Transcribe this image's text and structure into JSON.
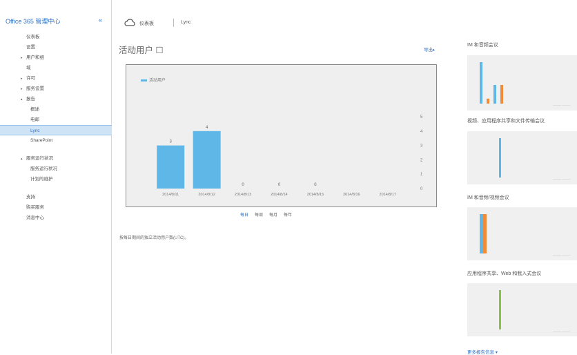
{
  "sidebar": {
    "title": "Office 365 管理中心",
    "collapse_icon": "chevron-left-icon",
    "items": [
      {
        "label": "仪表板",
        "level": 0,
        "expand": "",
        "selected": false
      },
      {
        "label": "设置",
        "level": 0,
        "expand": "",
        "selected": false
      },
      {
        "label": "用户和组",
        "level": 0,
        "expand": "▸",
        "selected": false
      },
      {
        "label": "域",
        "level": 0,
        "expand": "",
        "selected": false
      },
      {
        "label": "许可",
        "level": 0,
        "expand": "▸",
        "selected": false
      },
      {
        "label": "服务设置",
        "level": 0,
        "expand": "▸",
        "selected": false
      },
      {
        "label": "报告",
        "level": 0,
        "expand": "▴",
        "selected": false
      },
      {
        "label": "概述",
        "level": 1,
        "expand": "",
        "selected": false
      },
      {
        "label": "电邮",
        "level": 1,
        "expand": "",
        "selected": false
      },
      {
        "label": "Lync",
        "level": 1,
        "expand": "",
        "selected": true
      },
      {
        "label": "SharePoint",
        "level": 1,
        "expand": "",
        "selected": false
      },
      {
        "label": "",
        "level": -1,
        "expand": "",
        "selected": false
      },
      {
        "label": "服务运行状况",
        "level": 0,
        "expand": "▴",
        "selected": false
      },
      {
        "label": "服务运行状况",
        "level": 1,
        "expand": "",
        "selected": false
      },
      {
        "label": "计划的维护",
        "level": 1,
        "expand": "",
        "selected": false
      },
      {
        "label": "",
        "level": -1,
        "expand": "",
        "selected": false
      },
      {
        "label": "支持",
        "level": 0,
        "expand": "",
        "selected": false
      },
      {
        "label": "购买服务",
        "level": 0,
        "expand": "",
        "selected": false
      },
      {
        "label": "消息中心",
        "level": 0,
        "expand": "",
        "selected": false
      }
    ]
  },
  "topbar": {
    "icon": "cloud-icon",
    "title": "仪表板",
    "subtitle": "Lync"
  },
  "main": {
    "title": "活动用户 ☐",
    "export_label": "导出▸",
    "tabs": [
      "每日",
      "每周",
      "每月",
      "每年"
    ],
    "active_tab": 0,
    "note": "按每日期间的独立活动用户数(UTC)。"
  },
  "chart_data": {
    "type": "bar",
    "legend": [
      "活动用户"
    ],
    "categories": [
      "2014/8/11",
      "2014/8/12",
      "2014/8/13",
      "2014/8/14",
      "2014/8/15",
      "2014/8/16",
      "2014/8/17"
    ],
    "values": [
      3,
      4,
      0,
      0,
      0,
      0,
      0
    ],
    "value_labels": [
      "3",
      "4",
      "0",
      "0",
      "0",
      "",
      ""
    ],
    "ylim": [
      0,
      5
    ],
    "yticks": [
      "0",
      "1",
      "2",
      "3",
      "4",
      "5"
    ],
    "y_axis_side": "right",
    "bar_color": "#5fb7e8"
  },
  "right_panel": {
    "cards": [
      {
        "title": "IM 和音频会议",
        "footer": "——— ———",
        "bars": [
          {
            "color": "#5fb7e8",
            "value": 1.0,
            "slot": 0
          },
          {
            "color": "#5fb7e8",
            "value": 0.45,
            "slot": 1
          },
          {
            "color": "#f08b3a",
            "value": 0.45,
            "slot": 2
          },
          {
            "color": "#f08b3a",
            "value": 0.12,
            "slot": 0.55
          }
        ]
      },
      {
        "title": "视频、应用程序共享和文件传输会议",
        "footer": "——— ———",
        "bars": [
          {
            "color": "#5fb7e8",
            "value": 1.0,
            "slot": 0.55
          }
        ]
      },
      {
        "title": "IM 和音频/视频会议",
        "footer": "——— ———",
        "bars": [
          {
            "color": "#5fb7e8",
            "value": 1.0,
            "slot": 0
          },
          {
            "color": "#f08b3a",
            "value": 1.0,
            "slot": 0.35
          }
        ]
      },
      {
        "title": "应用程序共享、Web 和我入式会议",
        "footer": "——— ———",
        "bars": [
          {
            "color": "#8cc04c",
            "value": 1.0,
            "slot": 0.55
          }
        ]
      }
    ],
    "more_link": "更多报告信息 ▾"
  }
}
